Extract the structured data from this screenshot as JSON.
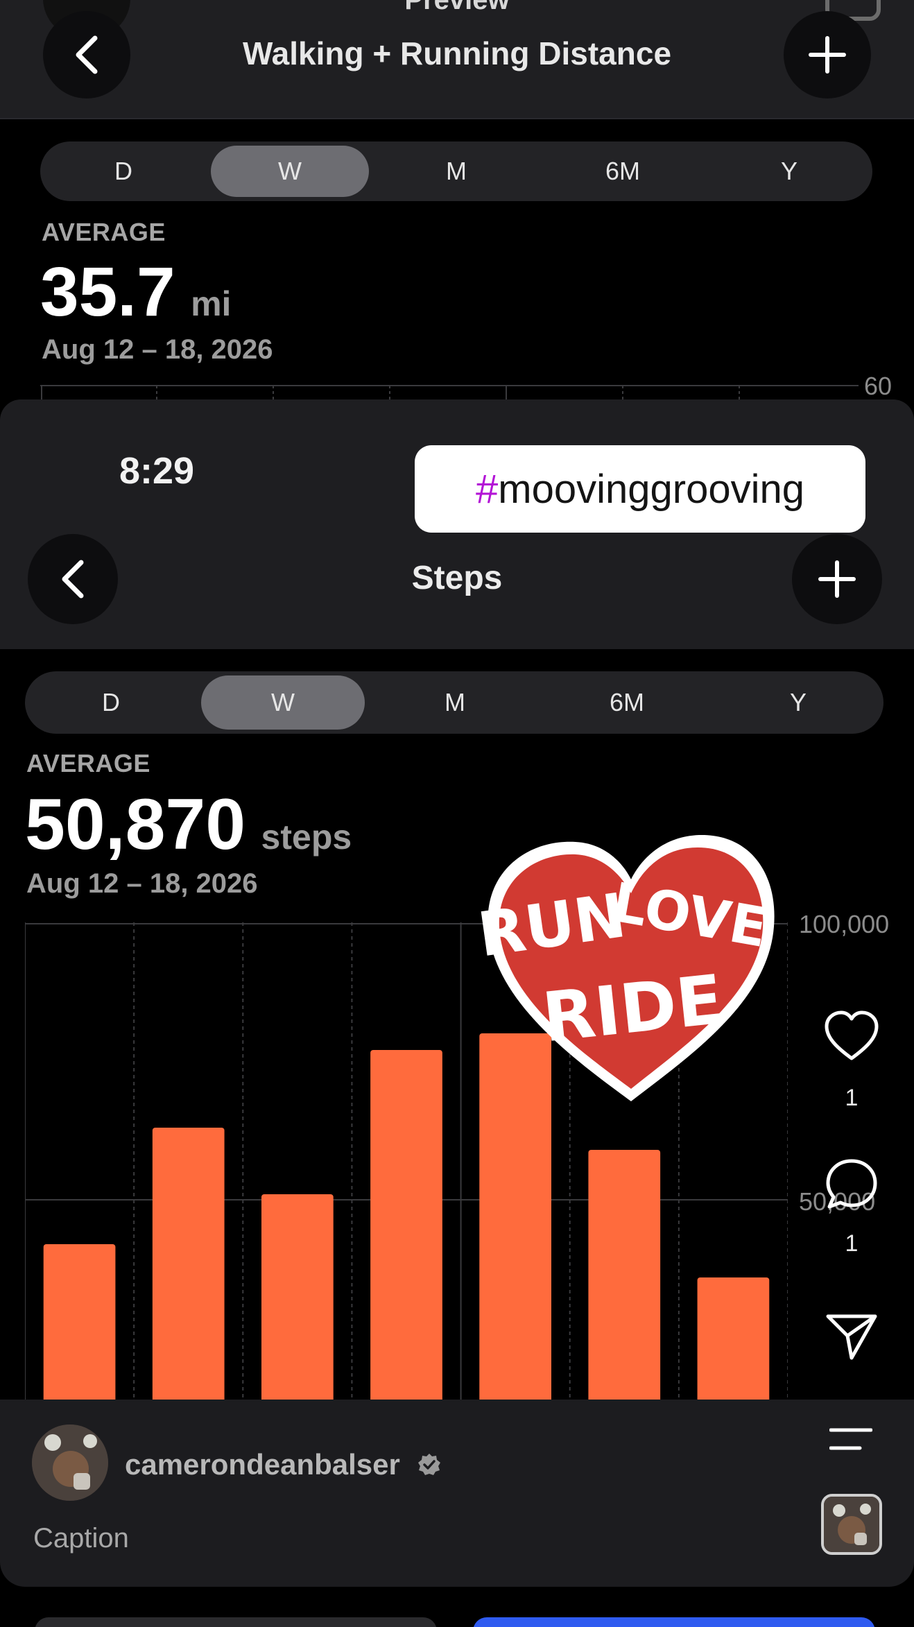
{
  "top_story": {
    "preview_label": "Preview",
    "title": "Walking + Running Distance",
    "segments": [
      "D",
      "W",
      "M",
      "6M",
      "Y"
    ],
    "selected_segment": "W",
    "average_label": "AVERAGE",
    "average_value": "35.7",
    "average_unit": "mi",
    "date_range": "Aug 12 – 18, 2026",
    "axis_top": "60"
  },
  "steps_card": {
    "time": "8:29",
    "hashtag_symbol": "#",
    "hashtag_text": "moovinggrooving",
    "title": "Steps",
    "segments": [
      "D",
      "W",
      "M",
      "6M",
      "Y"
    ],
    "selected_segment": "W",
    "average_label": "AVERAGE",
    "average_value": "50,870",
    "average_unit": "steps",
    "date_range": "Aug 12 – 18, 2026",
    "sticker_text": [
      "RUN",
      "LOVE",
      "RIDE"
    ]
  },
  "chart_data": {
    "type": "bar",
    "categories": [
      "",
      "",
      "",
      "",
      "",
      "",
      ""
    ],
    "values": [
      42000,
      63000,
      51000,
      77000,
      80000,
      59000,
      36000
    ],
    "ylim": [
      0,
      100000
    ],
    "ytick_labels": [
      "100,000",
      "50,000"
    ],
    "bar_color": "#ff6b3d",
    "grid": true
  },
  "rail": {
    "like_count": "1",
    "comment_count": "1"
  },
  "bottom_sheet": {
    "username": "camerondeanbalser",
    "caption_placeholder": "Caption"
  },
  "icons": [
    "back-chevron-icon",
    "plus-icon",
    "heart-icon",
    "comment-icon",
    "send-icon",
    "menu-icon",
    "verified-badge-icon",
    "camera-icon"
  ],
  "colors": {
    "accent": "#ff6b3d",
    "hashtag": "#b314d6",
    "share_button": "#2f5bf0"
  }
}
